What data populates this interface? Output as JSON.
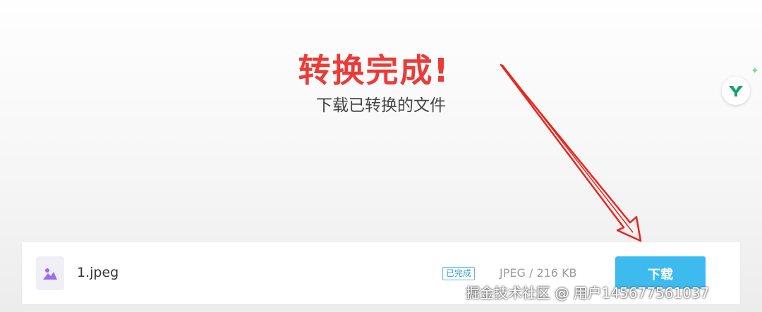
{
  "header": {
    "title": "转换完成!",
    "subtitle": "下载已转换的文件"
  },
  "assistant": {
    "icon": "y-logo-icon",
    "sparkle_icon": "sparkle-icon"
  },
  "file": {
    "name": "1.jpeg",
    "status": "已完成",
    "meta": "JPEG / 216 KB",
    "download_label": "下载",
    "icon": "image-file-icon"
  },
  "colors": {
    "title": "#ec3b37",
    "button": "#3dbbee",
    "arrow": "#e8271f",
    "status": "#2c9fd3"
  },
  "watermark": "掘金技术社区 @ 用户145677561037"
}
